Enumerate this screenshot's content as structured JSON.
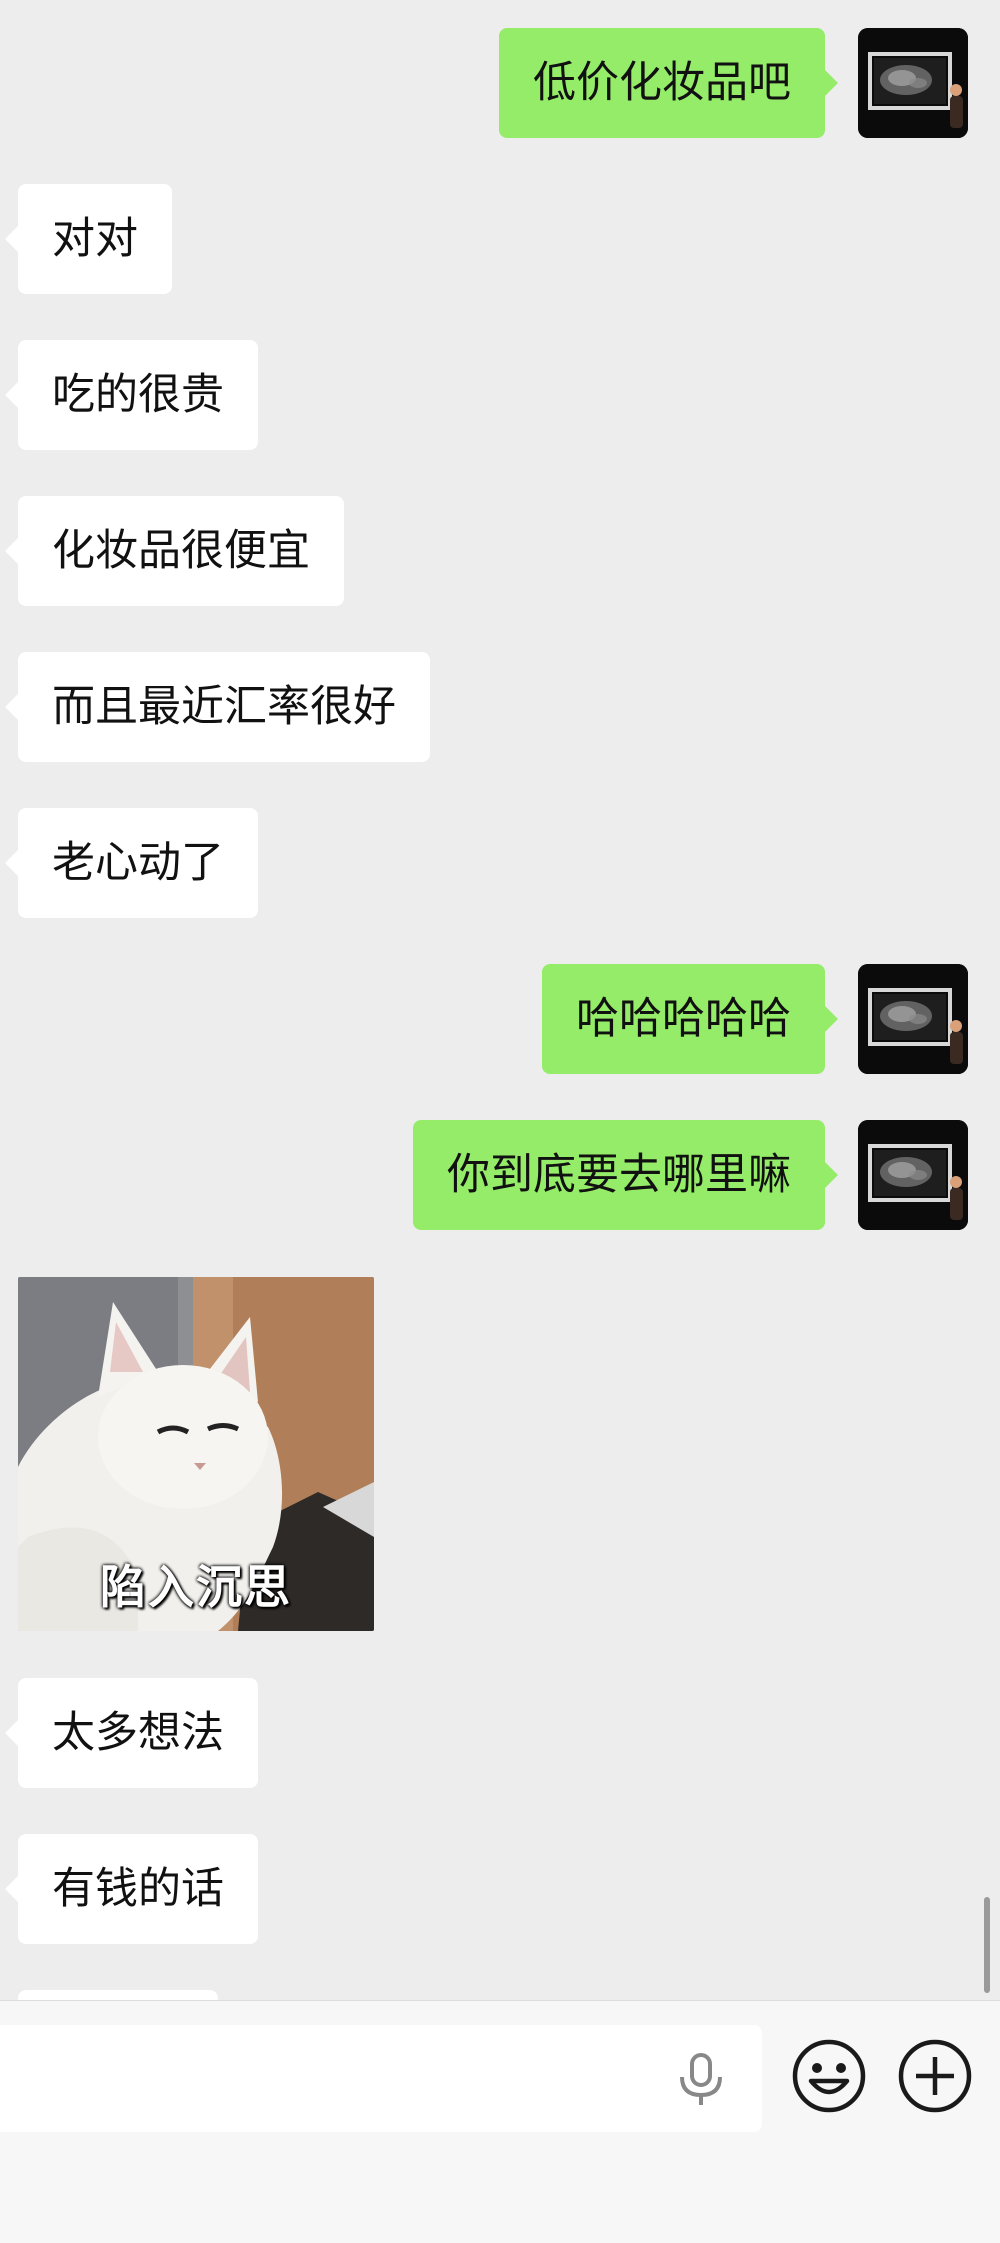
{
  "messages": [
    {
      "side": "out",
      "text": "低价化妆品吧"
    },
    {
      "side": "in",
      "text": "对对"
    },
    {
      "side": "in",
      "text": "吃的很贵"
    },
    {
      "side": "in",
      "text": "化妆品很便宜"
    },
    {
      "side": "in",
      "text": "而且最近汇率很好"
    },
    {
      "side": "in",
      "text": "老心动了"
    },
    {
      "side": "out",
      "text": "哈哈哈哈哈"
    },
    {
      "side": "out",
      "text": "你到底要去哪里嘛"
    },
    {
      "side": "in",
      "type": "sticker",
      "caption": "陷入沉思"
    },
    {
      "side": "in",
      "text": "太多想法"
    },
    {
      "side": "in",
      "text": "有钱的话"
    }
  ],
  "input": {
    "value": "",
    "mic_icon": "microphone-icon",
    "emoji_icon": "emoji-icon",
    "plus_icon": "plus-icon"
  },
  "colors": {
    "background": "#ededed",
    "outgoing_bubble": "#95ec69",
    "incoming_bubble": "#ffffff",
    "input_bar": "#f7f7f7"
  }
}
